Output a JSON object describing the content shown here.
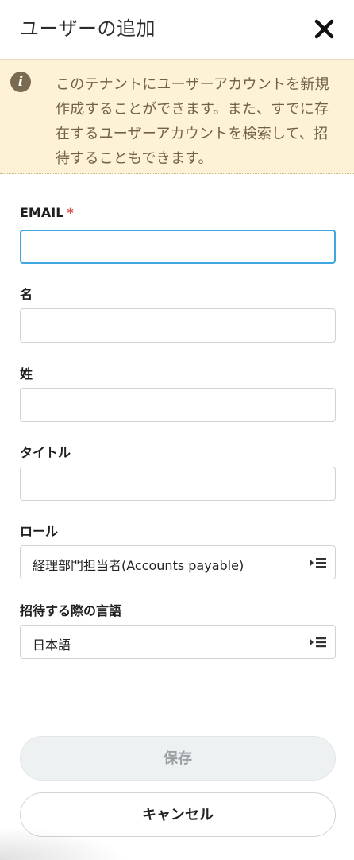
{
  "header": {
    "title": "ユーザーの追加",
    "close_icon": "close-icon"
  },
  "notice": {
    "icon": "info-icon",
    "text": "このテナントにユーザーアカウントを新規作成することができます。また、すでに存在するユーザーアカウントを検索して、招待することもできます。"
  },
  "form": {
    "email": {
      "label": "EMAIL",
      "required_mark": "*",
      "value": ""
    },
    "first_name": {
      "label": "名",
      "value": ""
    },
    "last_name": {
      "label": "姓",
      "value": ""
    },
    "title": {
      "label": "タイトル",
      "value": ""
    },
    "role": {
      "label": "ロール",
      "selected": "経理部門担当者(Accounts payable)",
      "icon": "list-select-icon"
    },
    "invite_language": {
      "label": "招待する際の言語",
      "selected": "日本語",
      "icon": "list-select-icon"
    }
  },
  "actions": {
    "save_label": "保存",
    "cancel_label": "キャンセル"
  },
  "colors": {
    "notice_bg": "#fdf1d6",
    "notice_text": "#6f6248",
    "focus_border": "#3ea7e0",
    "required": "#d9534f",
    "disabled_button_bg": "#eef1f2"
  }
}
